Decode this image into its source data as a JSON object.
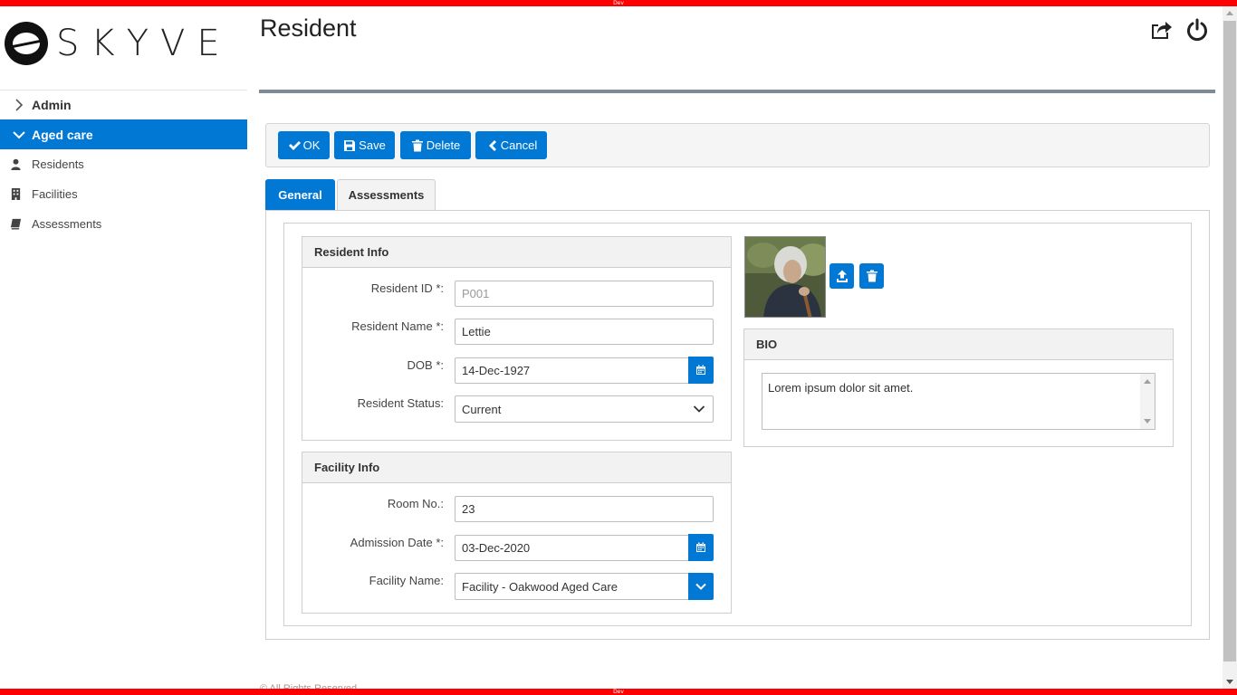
{
  "env_label": "Dev",
  "brand": {
    "logo_text": "SKYVE"
  },
  "sidebar": {
    "groups": [
      {
        "label": "Admin",
        "expanded": false
      },
      {
        "label": "Aged care",
        "expanded": true
      }
    ],
    "items": [
      {
        "label": "Residents",
        "icon": "user-icon"
      },
      {
        "label": "Facilities",
        "icon": "building-icon"
      },
      {
        "label": "Assessments",
        "icon": "book-icon"
      }
    ]
  },
  "header": {
    "title": "Resident",
    "icons": [
      "share-icon",
      "power-icon"
    ]
  },
  "toolbar": {
    "ok_label": "OK",
    "save_label": "Save",
    "delete_label": "Delete",
    "cancel_label": "Cancel"
  },
  "tabs": [
    {
      "label": "General",
      "active": true
    },
    {
      "label": "Assessments",
      "active": false
    }
  ],
  "resident_info": {
    "title": "Resident Info",
    "resident_id_label": "Resident ID *:",
    "resident_id_value": "P001",
    "resident_name_label": "Resident Name *:",
    "resident_name_value": "Lettie",
    "dob_label": "DOB *:",
    "dob_value": "14-Dec-1927",
    "status_label": "Resident Status:",
    "status_value": "Current"
  },
  "facility_info": {
    "title": "Facility Info",
    "room_label": "Room No.:",
    "room_value": "23",
    "admission_label": "Admission Date *:",
    "admission_value": "03-Dec-2020",
    "facility_label": "Facility Name:",
    "facility_value": "Facility - Oakwood Aged Care"
  },
  "bio": {
    "title": "BIO",
    "text": "Lorem ipsum dolor sit amet."
  },
  "footer": {
    "text": "© All Rights Reserved"
  },
  "colors": {
    "accent": "#0078d4",
    "dev_bar": "#ff0000"
  }
}
